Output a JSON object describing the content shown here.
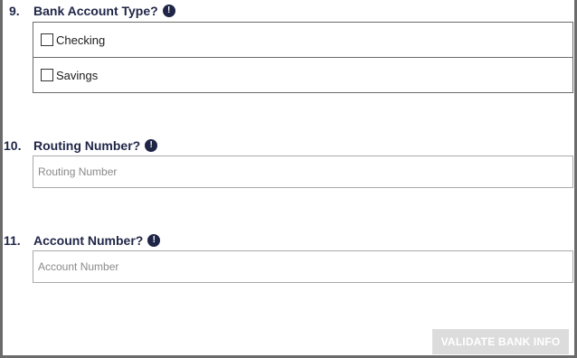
{
  "form": {
    "bank_account_type": {
      "number": "9.",
      "label": "Bank Account Type?",
      "info_icon": "info-icon",
      "options": [
        {
          "label": "Checking",
          "checked": false
        },
        {
          "label": "Savings",
          "checked": false
        }
      ]
    },
    "routing_number": {
      "number": "10.",
      "label": "Routing Number?",
      "info_icon": "info-icon",
      "value": "",
      "placeholder": "Routing Number"
    },
    "account_number": {
      "number": "11.",
      "label": "Account Number?",
      "info_icon": "info-icon",
      "value": "",
      "placeholder": "Account Number"
    },
    "validate_button_label": "VALIDATE BANK INFO"
  },
  "colors": {
    "label_text": "#1f2547",
    "button_disabled_bg": "#dcdcdc",
    "button_text": "#ffffff",
    "frame": "#6b6b6b"
  }
}
